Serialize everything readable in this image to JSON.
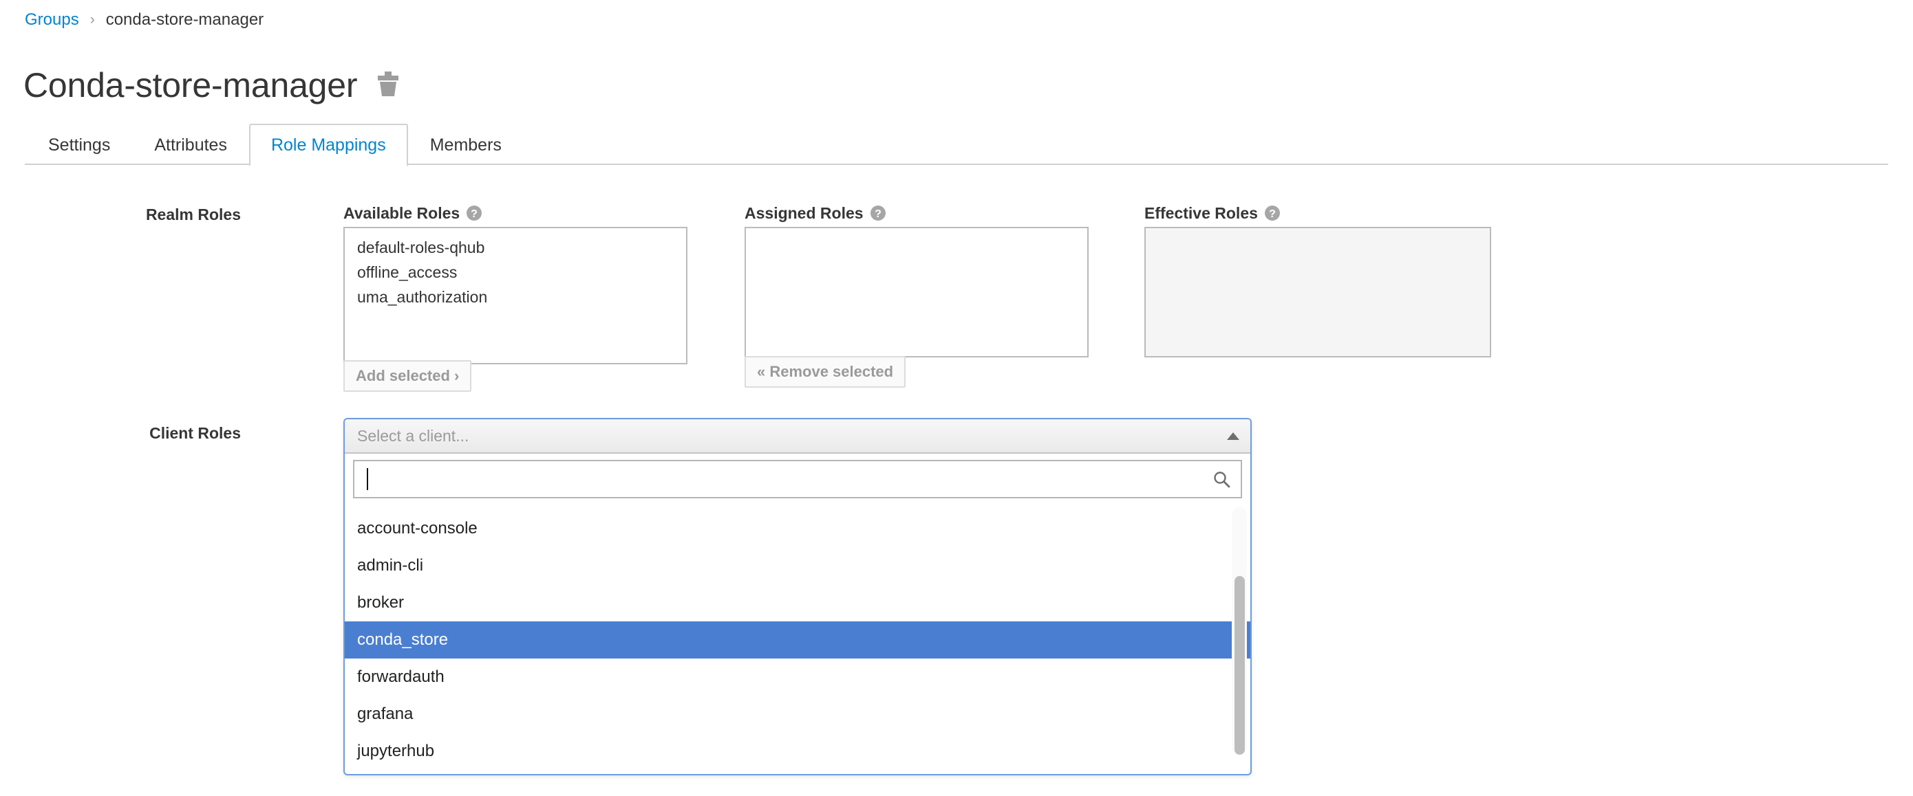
{
  "breadcrumb": {
    "parent_label": "Groups",
    "separator": "›",
    "current_label": "conda-store-manager"
  },
  "header": {
    "title": "Conda-store-manager",
    "delete_icon": "trash-icon"
  },
  "tabs": [
    {
      "label": "Settings",
      "active": false
    },
    {
      "label": "Attributes",
      "active": false
    },
    {
      "label": "Role Mappings",
      "active": true
    },
    {
      "label": "Members",
      "active": false
    }
  ],
  "realm_roles": {
    "row_label": "Realm Roles",
    "available": {
      "title": "Available Roles",
      "help_icon": "help-circle-icon",
      "options": [
        "default-roles-qhub",
        "offline_access",
        "uma_authorization"
      ],
      "add_button_label": "Add selected ›"
    },
    "assigned": {
      "title": "Assigned Roles",
      "help_icon": "help-circle-icon",
      "options": [],
      "remove_button_label": "« Remove selected"
    },
    "effective": {
      "title": "Effective Roles",
      "help_icon": "help-circle-icon",
      "options": [],
      "readonly": true
    }
  },
  "client_roles": {
    "row_label": "Client Roles",
    "select_placeholder": "Select a client...",
    "caret_icon": "chevron-up-icon",
    "search": {
      "value": "",
      "placeholder": "",
      "icon": "search-icon"
    },
    "options": [
      {
        "label": "account-console",
        "selected": false
      },
      {
        "label": "admin-cli",
        "selected": false
      },
      {
        "label": "broker",
        "selected": false
      },
      {
        "label": "conda_store",
        "selected": true
      },
      {
        "label": "forwardauth",
        "selected": false
      },
      {
        "label": "grafana",
        "selected": false
      },
      {
        "label": "jupyterhub",
        "selected": false
      }
    ],
    "selected_value": "conda_store"
  },
  "colors": {
    "link_blue": "#0085cf",
    "tab_active_blue": "#0085cf",
    "highlight_blue": "#4a7ed1",
    "focus_border_blue": "#6c9ce0",
    "text_dark": "#363636",
    "border_gray": "#bbbbbb",
    "readonly_bg": "#f5f5f5"
  }
}
